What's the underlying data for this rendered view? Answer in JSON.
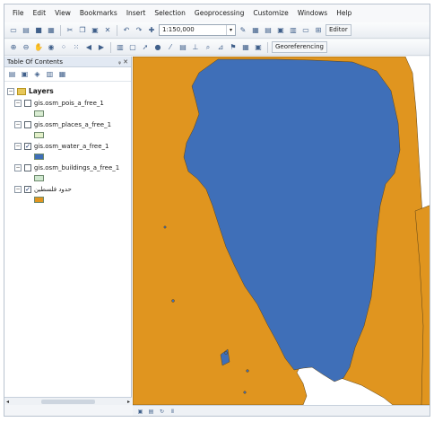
{
  "menu": [
    "File",
    "Edit",
    "View",
    "Bookmarks",
    "Insert",
    "Selection",
    "Geoprocessing",
    "Customize",
    "Windows",
    "Help"
  ],
  "toolbar": {
    "scale": "1:150,000",
    "editor_label": "Editor",
    "georeferencing_label": "Georeferencing"
  },
  "toc": {
    "title": "Table Of Contents",
    "root_label": "Layers",
    "layers": [
      {
        "name": "gis.osm_pois_a_free_1",
        "checked": false,
        "color": "#d9ecd2"
      },
      {
        "name": "gis.osm_places_a_free_1",
        "checked": false,
        "color": "#e3f0c9"
      },
      {
        "name": "gis.osm_water_a_free_1",
        "checked": true,
        "color": "#3f6fb8"
      },
      {
        "name": "gis.osm_buildings_a_free_1",
        "checked": false,
        "color": "#cfe8cf"
      },
      {
        "name": "حدود فلسطين",
        "checked": true,
        "color": "#e0951f"
      }
    ]
  },
  "colors": {
    "land": "#e0951f",
    "water": "#3f6fb8",
    "outline": "#5a4218"
  }
}
